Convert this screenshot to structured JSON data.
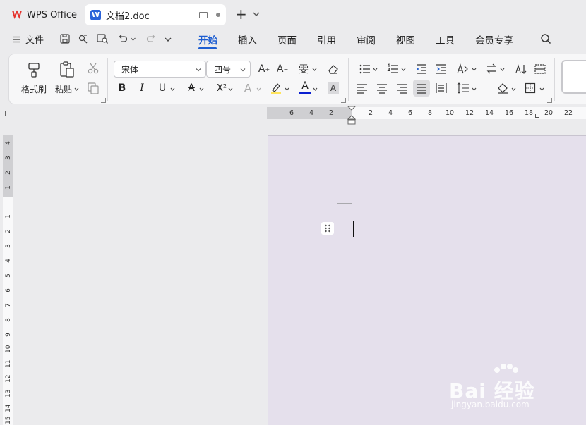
{
  "title_bar": {
    "app_tab": "WPS Office",
    "doc_tab": "文档2.doc"
  },
  "menu": {
    "file": "文件",
    "tabs": [
      {
        "label": "开始",
        "active": true
      },
      {
        "label": "插入"
      },
      {
        "label": "页面"
      },
      {
        "label": "引用"
      },
      {
        "label": "审阅"
      },
      {
        "label": "视图"
      },
      {
        "label": "工具"
      },
      {
        "label": "会员专享"
      }
    ]
  },
  "ribbon": {
    "format_painter": "格式刷",
    "paste": "粘贴",
    "font_name": "宋体",
    "font_size": "四号",
    "bold": "B",
    "italic": "I",
    "underline": "U",
    "superscript": "X²",
    "wen": "雯",
    "text_a": "A"
  },
  "ruler": {
    "top": [
      "6",
      "4",
      "2",
      "2",
      "4",
      "6",
      "8",
      "10",
      "12",
      "14",
      "16",
      "18",
      "20",
      "22"
    ],
    "left": [
      "4",
      "3",
      "2",
      "1",
      "1",
      "2",
      "3",
      "4",
      "5",
      "6",
      "7",
      "8",
      "9",
      "10",
      "11",
      "12",
      "13",
      "14",
      "15"
    ]
  },
  "watermark": {
    "brand": "Bai  经验",
    "url": "jingyan.baidu.com"
  },
  "colors": {
    "accent": "#1e5ed1",
    "page": "#e5e0ec",
    "font_color": "#0a1fd0"
  }
}
